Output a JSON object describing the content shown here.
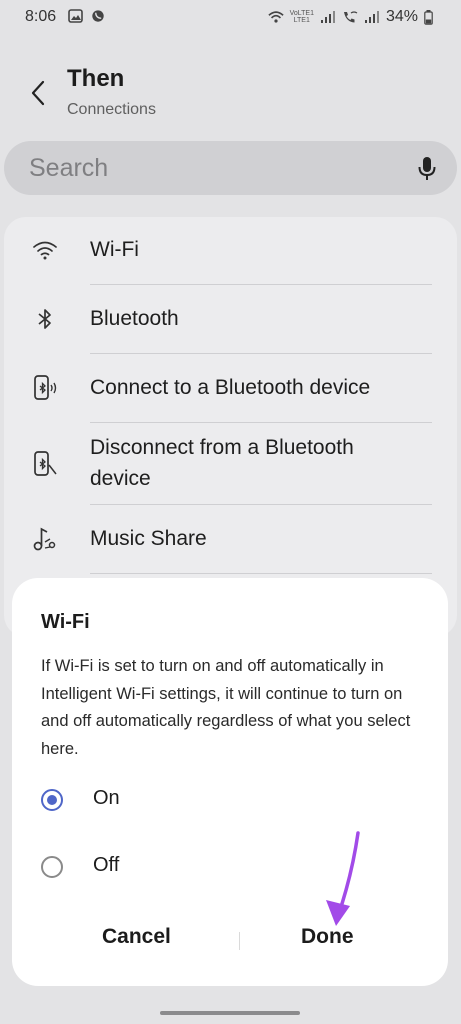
{
  "status_bar": {
    "time": "8:06",
    "network_top": "VoLTE1",
    "network_bottom": "LTE1",
    "battery": "34%"
  },
  "header": {
    "title": "Then",
    "subtitle": "Connections"
  },
  "search": {
    "placeholder": "Search"
  },
  "list": {
    "items": [
      {
        "label": "Wi-Fi",
        "icon": "wifi-icon"
      },
      {
        "label": "Bluetooth",
        "icon": "bluetooth-icon"
      },
      {
        "label": "Connect to a Bluetooth device",
        "icon": "phone-bluetooth-icon"
      },
      {
        "label_line1": "Disconnect from a Bluetooth",
        "label_line2": "device",
        "icon": "phone-bluetooth-off-icon"
      },
      {
        "label": "Music Share",
        "icon": "music-share-icon"
      }
    ]
  },
  "dialog": {
    "title": "Wi-Fi",
    "body": "If Wi-Fi is set to turn on and off automatically in Intelligent Wi-Fi settings, it will continue to turn on and off automatically regardless of what you select here.",
    "options": [
      {
        "label": "On",
        "selected": true
      },
      {
        "label": "Off",
        "selected": false
      }
    ],
    "cancel_label": "Cancel",
    "done_label": "Done"
  },
  "colors": {
    "accent": "#4f66c8",
    "annotation_arrow": "#a24be8"
  }
}
